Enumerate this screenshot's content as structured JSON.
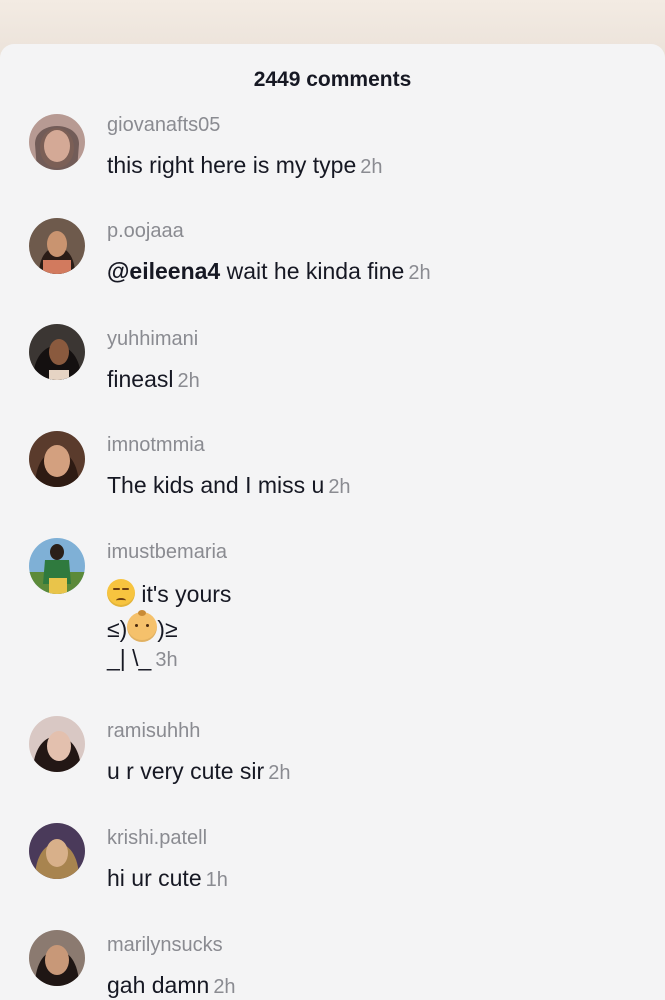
{
  "sheet": {
    "title": "2449 comments"
  },
  "comments": [
    {
      "username": "giovanafts05",
      "text": "this right here is my type",
      "time": "2h"
    },
    {
      "username": "p.oojaaa",
      "mention": "@eileena4",
      "text": " wait he kinda fine",
      "time": "2h"
    },
    {
      "username": "yuhhimani",
      "text": "fineasl",
      "time": "2h"
    },
    {
      "username": "imnotmmia",
      "text": "The kids and I miss u",
      "time": "2h"
    },
    {
      "username": "imustbemaria",
      "line1": " it's yours",
      "line2a": "≤)",
      "line2b": ")≥",
      "line3": "_| \\_",
      "time": "3h",
      "emojis": [
        "unamused-face-emoji",
        "baby-face-emoji"
      ]
    },
    {
      "username": "ramisuhhh",
      "text": "u r very cute sir",
      "time": "2h"
    },
    {
      "username": "krishi.patell",
      "text": "hi ur cute",
      "time": "1h"
    },
    {
      "username": "marilynsucks",
      "text": "gah damn",
      "time": "2h"
    }
  ]
}
